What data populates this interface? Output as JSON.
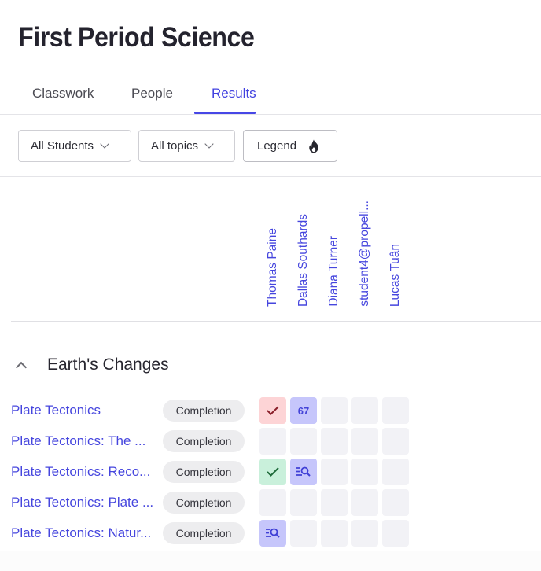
{
  "page": {
    "title": "First Period Science"
  },
  "tabs": [
    {
      "label": "Classwork",
      "active": false
    },
    {
      "label": "People",
      "active": false
    },
    {
      "label": "Results",
      "active": true
    }
  ],
  "colors": {
    "accent": "#4646de",
    "cell_empty": "#f2f2f6",
    "cell_incorrect": "#fdd4d6",
    "cell_correct": "#c9f0db",
    "cell_review": "#c6c6fb"
  },
  "filters": {
    "students": {
      "label": "All Students",
      "icon": "chevron-down-icon"
    },
    "topics": {
      "label": "All topics",
      "icon": "chevron-down-icon"
    },
    "legend": {
      "label": "Legend",
      "icon": "flame-icon"
    }
  },
  "students": [
    "Thomas Paine",
    "Dallas Southards",
    "Diana Turner",
    "student4@propell...",
    "Lucas Tuân"
  ],
  "section": {
    "title": "Earth's Changes",
    "expanded": true,
    "icon": "chevron-up-icon"
  },
  "assignments": [
    {
      "title": "Plate Tectonics",
      "type": "Completion",
      "cells": [
        {
          "status": "incorrect",
          "icon": "check-icon",
          "text": ""
        },
        {
          "status": "review",
          "icon": "",
          "text": "67"
        },
        {
          "status": "empty",
          "icon": "",
          "text": ""
        },
        {
          "status": "empty",
          "icon": "",
          "text": ""
        },
        {
          "status": "empty",
          "icon": "",
          "text": ""
        }
      ]
    },
    {
      "title": "Plate Tectonics: The ...",
      "type": "Completion",
      "cells": [
        {
          "status": "empty",
          "icon": "",
          "text": ""
        },
        {
          "status": "empty",
          "icon": "",
          "text": ""
        },
        {
          "status": "empty",
          "icon": "",
          "text": ""
        },
        {
          "status": "empty",
          "icon": "",
          "text": ""
        },
        {
          "status": "empty",
          "icon": "",
          "text": ""
        }
      ]
    },
    {
      "title": "Plate Tectonics: Reco...",
      "type": "Completion",
      "cells": [
        {
          "status": "correct",
          "icon": "check-icon",
          "text": ""
        },
        {
          "status": "review",
          "icon": "review-search-icon",
          "text": ""
        },
        {
          "status": "empty",
          "icon": "",
          "text": ""
        },
        {
          "status": "empty",
          "icon": "",
          "text": ""
        },
        {
          "status": "empty",
          "icon": "",
          "text": ""
        }
      ]
    },
    {
      "title": "Plate Tectonics: Plate ...",
      "type": "Completion",
      "cells": [
        {
          "status": "empty",
          "icon": "",
          "text": ""
        },
        {
          "status": "empty",
          "icon": "",
          "text": ""
        },
        {
          "status": "empty",
          "icon": "",
          "text": ""
        },
        {
          "status": "empty",
          "icon": "",
          "text": ""
        },
        {
          "status": "empty",
          "icon": "",
          "text": ""
        }
      ]
    },
    {
      "title": "Plate Tectonics: Natur...",
      "type": "Completion",
      "cells": [
        {
          "status": "review",
          "icon": "review-search-icon",
          "text": ""
        },
        {
          "status": "empty",
          "icon": "",
          "text": ""
        },
        {
          "status": "empty",
          "icon": "",
          "text": ""
        },
        {
          "status": "empty",
          "icon": "",
          "text": ""
        },
        {
          "status": "empty",
          "icon": "",
          "text": ""
        }
      ]
    }
  ]
}
